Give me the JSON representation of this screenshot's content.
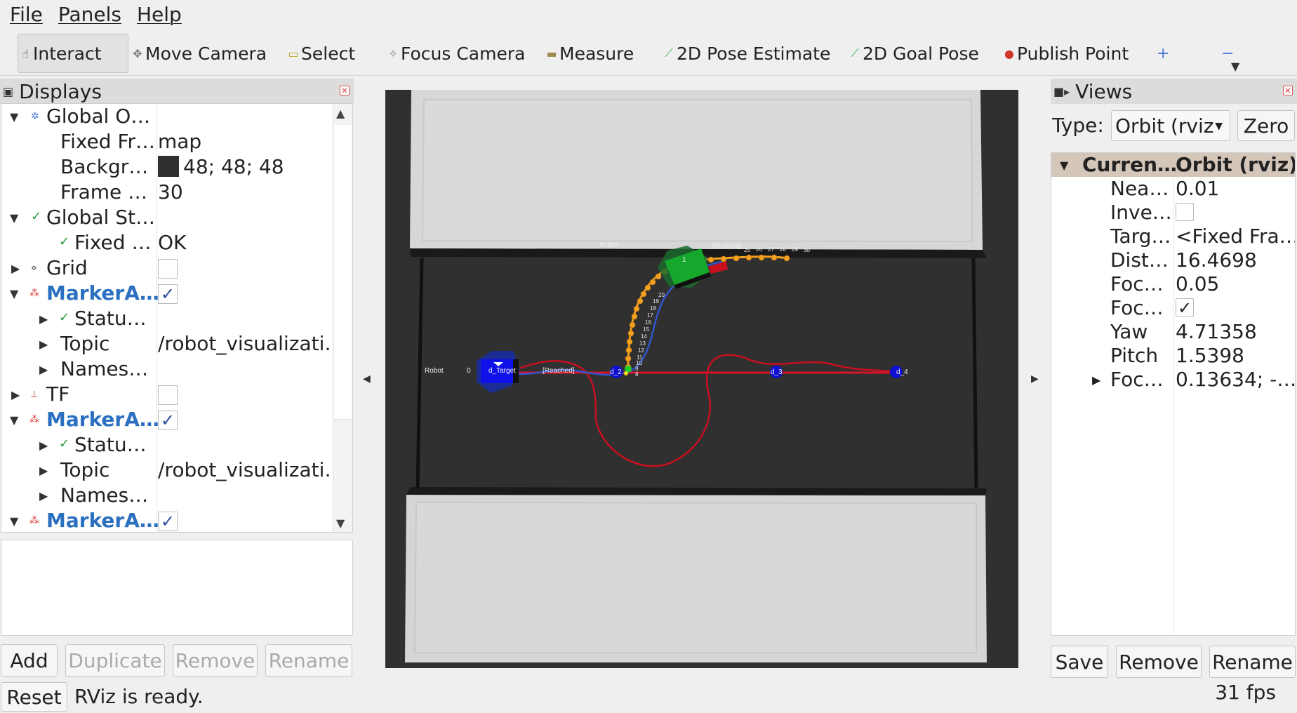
{
  "menu": [
    "File",
    "Panels",
    "Help"
  ],
  "toolbar": {
    "tools": [
      {
        "label": "Interact",
        "icon": "hand-pointer-icon",
        "glyph": "☝"
      },
      {
        "label": "Move Camera",
        "icon": "move-camera-icon",
        "glyph": "✥"
      },
      {
        "label": "Select",
        "icon": "select-box-icon",
        "glyph": "▭"
      },
      {
        "label": "Focus Camera",
        "icon": "focus-camera-icon",
        "glyph": "✧"
      },
      {
        "label": "Measure",
        "icon": "measure-icon",
        "glyph": "▬"
      },
      {
        "label": "2D Pose Estimate",
        "icon": "pose-estimate-arrow-icon",
        "glyph": "⟋"
      },
      {
        "label": "2D Goal Pose",
        "icon": "goal-pose-arrow-icon",
        "glyph": "⟋"
      },
      {
        "label": "Publish Point",
        "icon": "map-pin-icon",
        "glyph": "●"
      }
    ],
    "add_glyph": "+",
    "remove_glyph": "−"
  },
  "displays": {
    "title": "Displays",
    "rows": [
      {
        "name": "Global O…",
        "value": ""
      },
      {
        "name": "Fixed Fr…",
        "value": "map"
      },
      {
        "name": "Backgr…",
        "value": "48; 48; 48"
      },
      {
        "name": "Frame …",
        "value": "30"
      },
      {
        "name": "Global St…",
        "value": ""
      },
      {
        "name": "Fixed …",
        "value": "OK"
      },
      {
        "name": "Grid",
        "value": ""
      },
      {
        "name": "MarkerA…",
        "value": ""
      },
      {
        "name": "Statu…",
        "value": ""
      },
      {
        "name": "Topic",
        "value": "/robot_visualizati…"
      },
      {
        "name": "Names…",
        "value": ""
      },
      {
        "name": "TF",
        "value": ""
      },
      {
        "name": "MarkerA…",
        "value": ""
      },
      {
        "name": "Statu…",
        "value": ""
      },
      {
        "name": "Topic",
        "value": "/robot_visualizati…"
      },
      {
        "name": "Names…",
        "value": ""
      },
      {
        "name": "MarkerA…",
        "value": ""
      }
    ],
    "background_color": "#303030",
    "buttons": {
      "add": "Add",
      "duplicate": "Duplicate",
      "remove": "Remove",
      "rename": "Rename"
    }
  },
  "viewport": {
    "labels": {
      "robot_top": "Robot",
      "robot_top_id": "1",
      "running": "[Running]",
      "robot_left": "Robot",
      "robot_left_id": "0",
      "target": "d_Target",
      "reached": "[Reached]",
      "d2": "d_2",
      "d3": "d_3",
      "d4": "d_4"
    },
    "path_numbers_top": [
      "25",
      "26",
      "27",
      "28",
      "29",
      "30"
    ],
    "path_numbers_side": [
      "20",
      "19",
      "18",
      "17",
      "16",
      "15",
      "14",
      "13",
      "12",
      "11",
      "10",
      "9",
      "8"
    ],
    "colors": {
      "floor": "#303030",
      "wall": "#d9d9d9",
      "target_box": "#1010d0",
      "robot_box": "#16a82c",
      "red_path": "#d8142a",
      "blue_path": "#3355cc",
      "orange_dots": "#f4a020"
    }
  },
  "views": {
    "title": "Views",
    "type_label": "Type:",
    "type_value": "Orbit (rviz",
    "zero_label": "Zero",
    "header": {
      "name": "Curren…",
      "value": "Orbit (rviz)"
    },
    "rows": [
      {
        "name": "Nea…",
        "value": "0.01"
      },
      {
        "name": "Inve…",
        "value": ""
      },
      {
        "name": "Targ…",
        "value": "<Fixed Fra…"
      },
      {
        "name": "Dist…",
        "value": "16.4698"
      },
      {
        "name": "Foc…",
        "value": "0.05"
      },
      {
        "name": "Foc…",
        "value": ""
      },
      {
        "name": "Yaw",
        "value": "4.71358"
      },
      {
        "name": "Pitch",
        "value": "1.5398"
      },
      {
        "name": "Foc…",
        "value": "0.13634; -…"
      }
    ],
    "buttons": {
      "save": "Save",
      "remove": "Remove",
      "rename": "Rename"
    }
  },
  "status": {
    "reset": "Reset",
    "message": "RViz is ready.",
    "fps": "31 fps"
  }
}
